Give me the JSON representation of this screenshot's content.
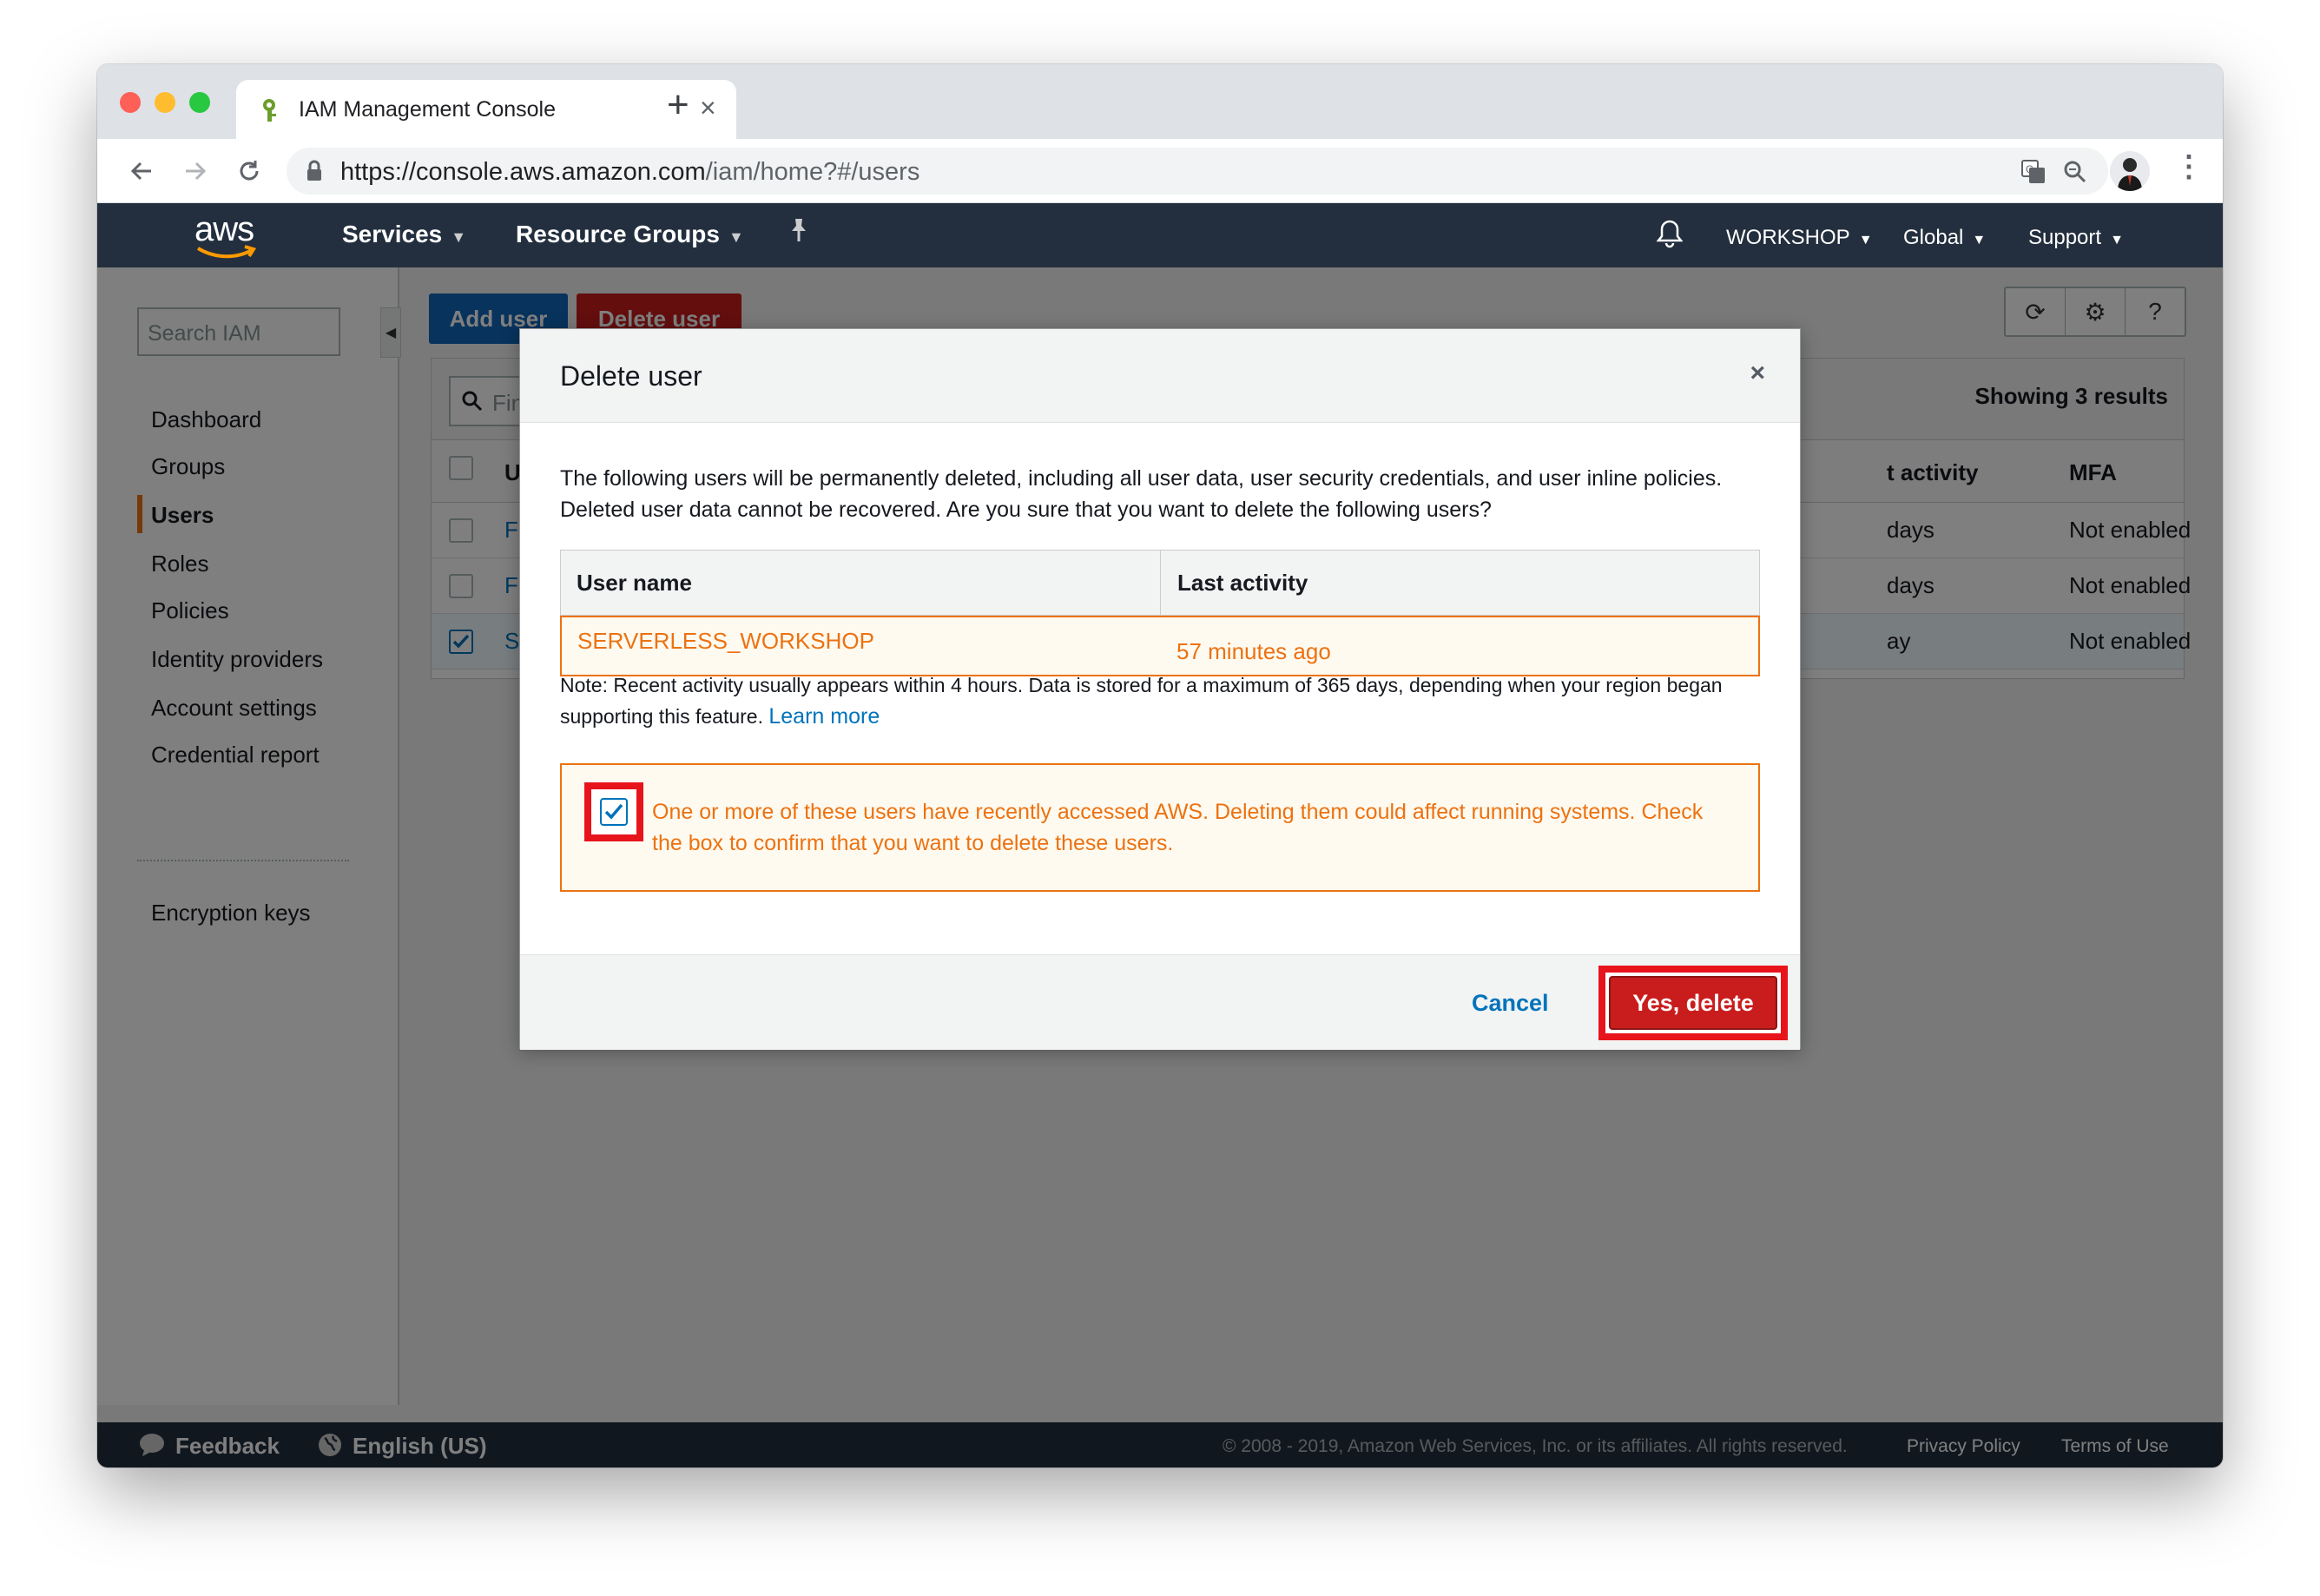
{
  "browser": {
    "tab_title": "IAM Management Console",
    "url_host": "https://console.aws.amazon.com",
    "url_path": "/iam/home?#/users"
  },
  "awsnav": {
    "logo_text": "aws",
    "services": "Services",
    "resource_groups": "Resource Groups",
    "account": "WORKSHOP",
    "region": "Global",
    "support": "Support"
  },
  "sidebar": {
    "search_placeholder": "Search IAM",
    "items": [
      {
        "label": "Dashboard"
      },
      {
        "label": "Groups"
      },
      {
        "label": "Users"
      },
      {
        "label": "Roles"
      },
      {
        "label": "Policies"
      },
      {
        "label": "Identity providers"
      },
      {
        "label": "Account settings"
      },
      {
        "label": "Credential report"
      }
    ],
    "encryption": "Encryption keys"
  },
  "main": {
    "add_user": "Add user",
    "delete_user": "Delete user",
    "filter_placeholder": "Fin",
    "showing": "Showing 3 results",
    "columns": {
      "user": "U",
      "activity": "t activity",
      "mfa": "MFA"
    },
    "rows": [
      {
        "name": "Fc",
        "activity": "days",
        "mfa": "Not enabled",
        "checked": false
      },
      {
        "name": "Fc",
        "activity": "days",
        "mfa": "Not enabled",
        "checked": false
      },
      {
        "name": "Sl",
        "activity": "ay",
        "mfa": "Not enabled",
        "checked": true
      }
    ]
  },
  "modal": {
    "title": "Delete user",
    "body": "The following users will be permanently deleted, including all user data, user security credentials, and user inline policies. Deleted user data cannot be recovered. Are you sure that you want to delete the following users?",
    "col_user": "User name",
    "col_activity": "Last activity",
    "row_user": "SERVERLESS_WORKSHOP",
    "row_activity": "57 minutes ago",
    "note": "Note: Recent activity usually appears within 4 hours. Data is stored for a maximum of 365 days, depending when your region began supporting this feature.",
    "learn_more": "Learn more",
    "warning": "One or more of these users have recently accessed AWS. Deleting them could affect running systems. Check the box to confirm that you want to delete these users.",
    "cancel": "Cancel",
    "confirm": "Yes, delete"
  },
  "footer": {
    "feedback": "Feedback",
    "language": "English (US)",
    "copyright": "© 2008 - 2019, Amazon Web Services, Inc. or its affiliates. All rights reserved.",
    "privacy": "Privacy Policy",
    "terms": "Terms of Use"
  },
  "colors": {
    "aws_nav": "#232f3e",
    "primary_blue": "#0073bb",
    "danger_red": "#c91c1c",
    "warning_orange": "#ec7211",
    "highlight_red": "#e8141c"
  }
}
